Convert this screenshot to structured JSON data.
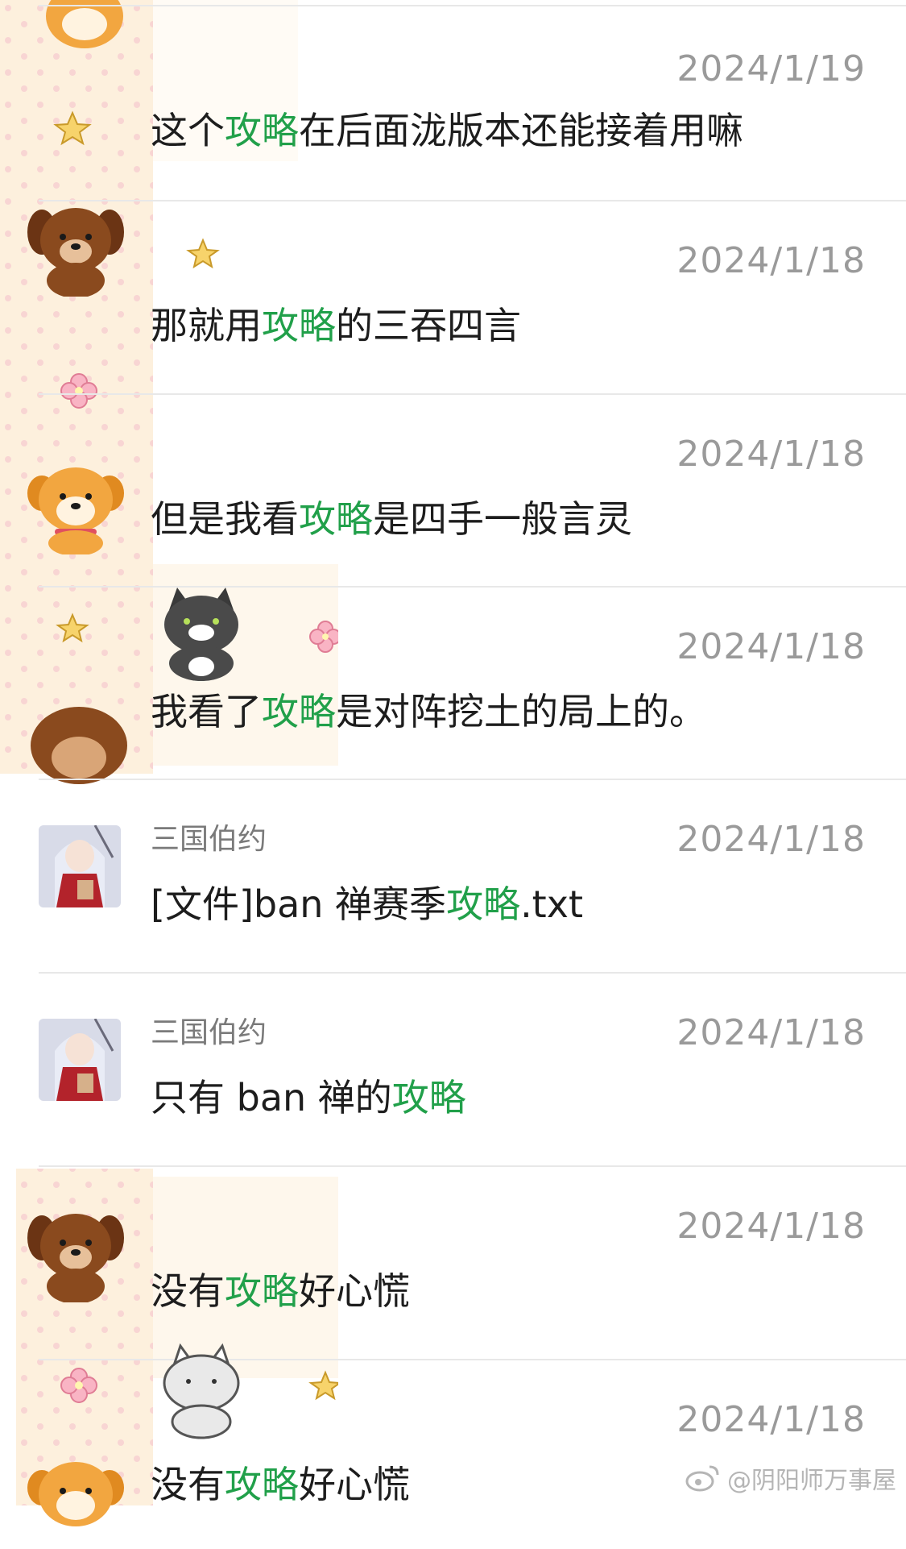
{
  "results": [
    {
      "name": "",
      "date": "2024/1/19",
      "pre": "这个",
      "hl": "攻略",
      "post": "在后面泷版本还能接着用嘛",
      "avatar": "bear-avatar-icon"
    },
    {
      "name": "",
      "date": "2024/1/18",
      "pre": "那就用",
      "hl": "攻略",
      "post": "的三吞四言",
      "avatar": "bear-avatar-icon"
    },
    {
      "name": "",
      "date": "2024/1/18",
      "pre": "但是我看",
      "hl": "攻略",
      "post": "是四手一般言灵",
      "avatar": "dog-avatar-icon"
    },
    {
      "name": "",
      "date": "2024/1/18",
      "pre": "我看了",
      "hl": "攻略",
      "post": "是对阵挖土的局上的。",
      "avatar": "cat-avatar-icon"
    },
    {
      "name": "三国伯约",
      "date": "2024/1/18",
      "pre": "[文件]ban 禅赛季",
      "hl": "攻略",
      "post": ".txt",
      "avatar": "anime-girl-avatar-icon"
    },
    {
      "name": "三国伯约",
      "date": "2024/1/18",
      "pre": "只有 ban 禅的",
      "hl": "攻略",
      "post": "",
      "avatar": "anime-girl-avatar-icon"
    },
    {
      "name": "",
      "date": "2024/1/18",
      "pre": "没有",
      "hl": "攻略",
      "post": "好心慌",
      "avatar": "bear-avatar-icon"
    },
    {
      "name": "",
      "date": "2024/1/18",
      "pre": "没有",
      "hl": "攻略",
      "post": "好心慌",
      "avatar": "dog-avatar-icon"
    }
  ],
  "watermark": "@阴阳师万事屋",
  "colors": {
    "highlight": "#21a04a",
    "date": "#9a9a9a",
    "name": "#7a7a7a",
    "divider": "#e8e8e8"
  }
}
